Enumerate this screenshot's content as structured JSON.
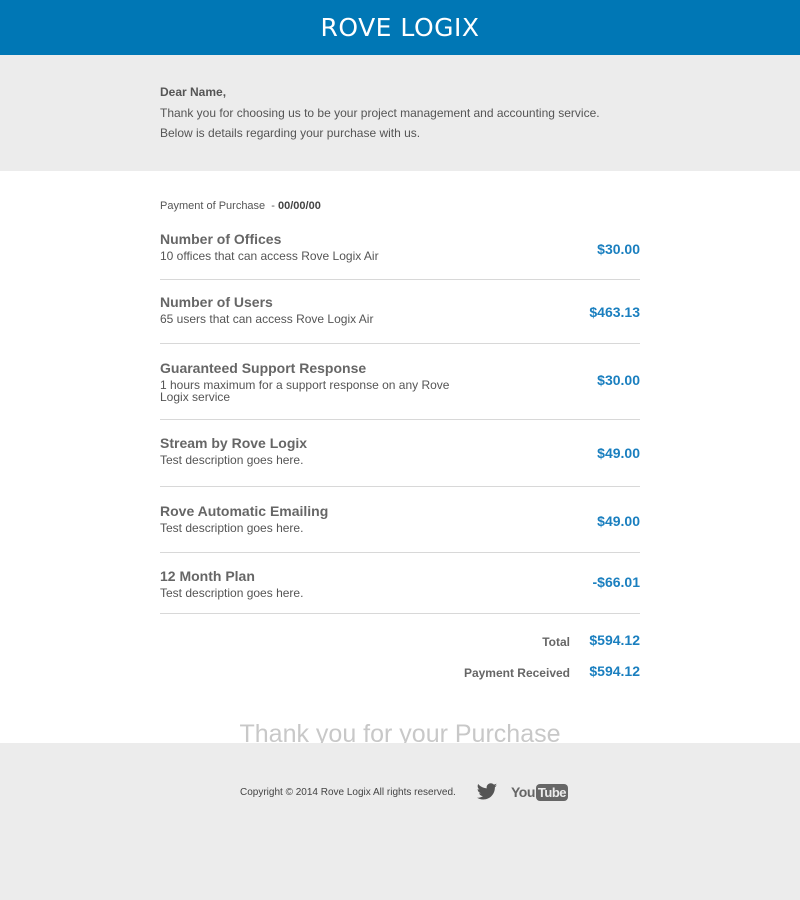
{
  "brand": {
    "logo_text": "ROVE LOGIX",
    "accent": "#0077b5",
    "price_color": "#1a7fbf"
  },
  "intro": {
    "greeting": "Dear Name,",
    "line1": "Thank you for choosing us to be your project management and accounting service.",
    "line2": "Below is details regarding your purchase with us."
  },
  "purchase": {
    "label": "Payment of Purchase  - ",
    "date": "00/00/00"
  },
  "items": [
    {
      "name": "Number of Offices",
      "description": "10 offices that can access Rove Logix Air",
      "price": "$30.00"
    },
    {
      "name": "Number of Users",
      "description": "65 users that can access Rove Logix Air",
      "price": "$463.13"
    },
    {
      "name": "Guaranteed Support Response",
      "description": "1 hours maximum for a support response on any Rove Logix service",
      "price": "$30.00"
    },
    {
      "name": "Stream by Rove Logix",
      "description": "Test description goes here.",
      "price": "$49.00"
    },
    {
      "name": "Rove Automatic Emailing",
      "description": "Test description goes here.",
      "price": "$49.00"
    },
    {
      "name": "12 Month Plan",
      "description": "Test description goes here.",
      "price": "-$66.01"
    }
  ],
  "totals": {
    "total_label": "Total",
    "total_value": "$594.12",
    "received_label": "Payment Received",
    "received_value": "$594.12"
  },
  "thanks": "Thank you for your Purchase",
  "footer": {
    "copyright": "Copyright © 2014 Rove Logix All rights reserved.",
    "twitter_icon": "twitter-icon",
    "youtube_you": "You",
    "youtube_tube": "Tube"
  }
}
